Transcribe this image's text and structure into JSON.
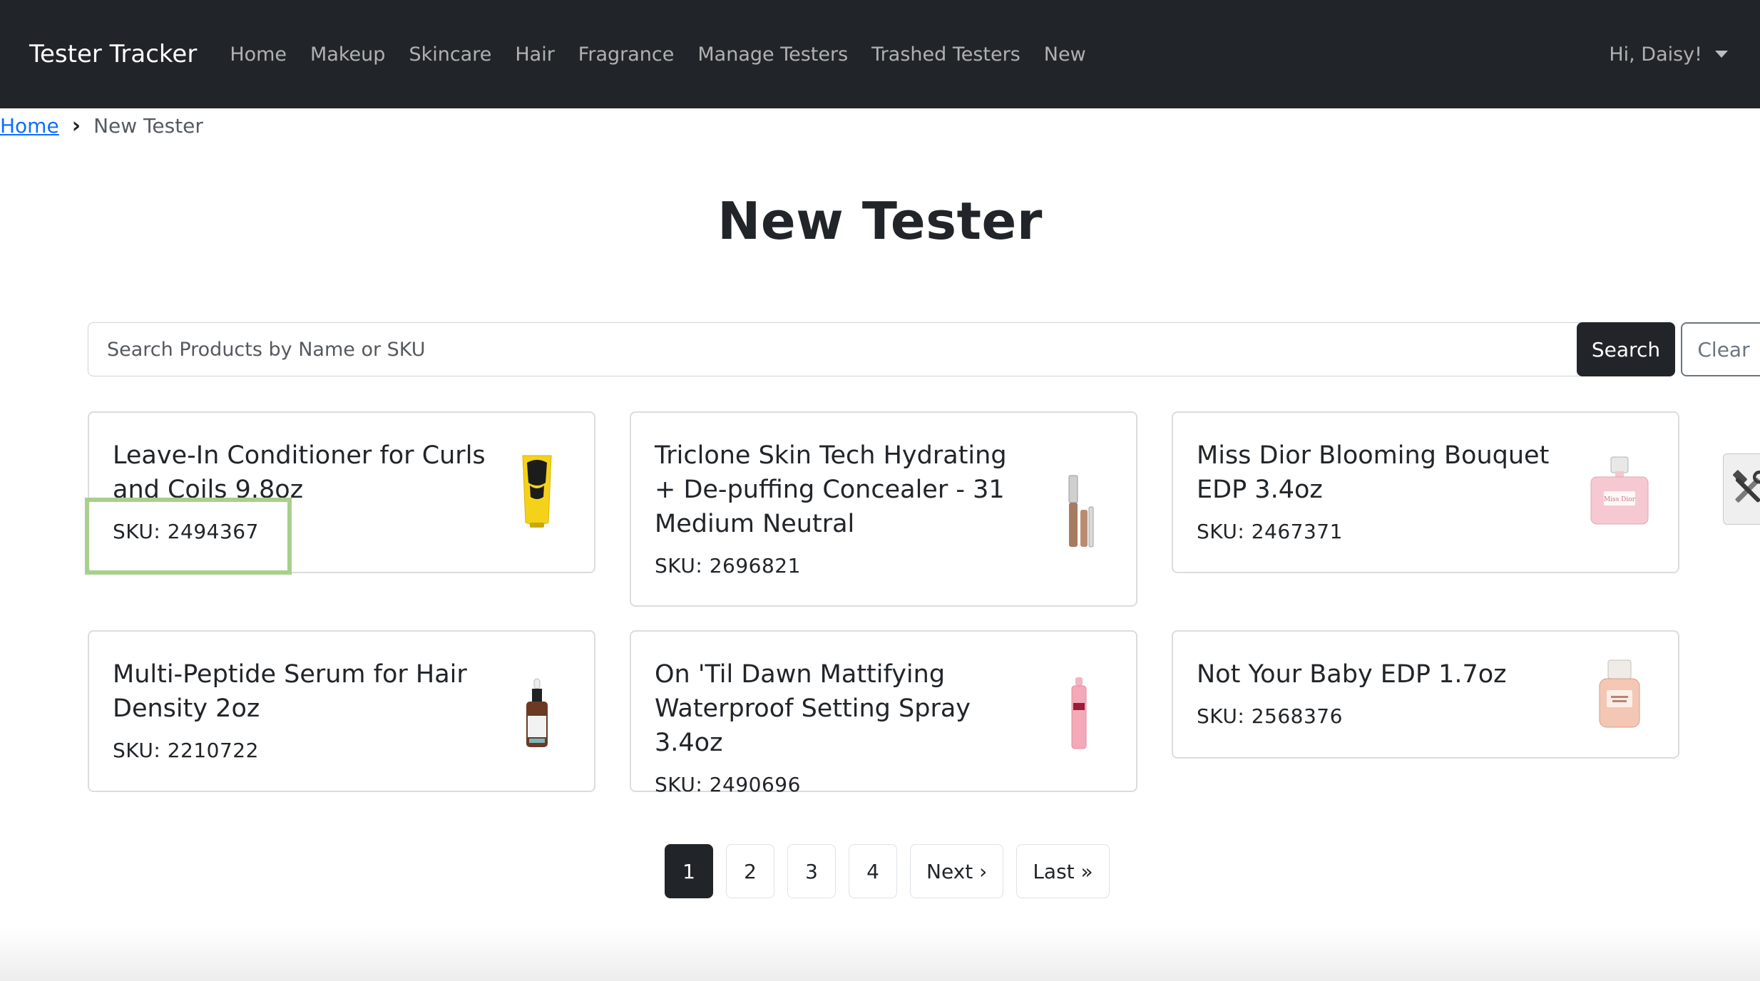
{
  "navbar": {
    "brand": "Tester Tracker",
    "links": [
      "Home",
      "Makeup",
      "Skincare",
      "Hair",
      "Fragrance",
      "Manage Testers",
      "Trashed Testers",
      "New"
    ],
    "user_greeting": "Hi, Daisy!"
  },
  "breadcrumb": {
    "home": "Home",
    "separator": "›",
    "current": "New Tester"
  },
  "page": {
    "title": "New Tester"
  },
  "search": {
    "placeholder": "Search Products by Name or SKU",
    "value": "",
    "search_label": "Search",
    "clear_label": "Clear"
  },
  "products": [
    {
      "name": "Leave-In Conditioner for Curls and Coils 9.8oz",
      "sku": "SKU: 2494367",
      "icon": "yellow-tube-product-icon"
    },
    {
      "name": "Triclone Skin Tech Hydrating + De-puffing Concealer - 31 Medium Neutral",
      "sku": "SKU: 2696821",
      "icon": "concealer-wand-product-icon"
    },
    {
      "name": "Miss Dior Blooming Bouquet EDP 3.4oz",
      "sku": "SKU: 2467371",
      "icon": "pink-perfume-bottle-icon"
    },
    {
      "name": "Multi-Peptide Serum for Hair Density 2oz",
      "sku": "SKU: 2210722",
      "icon": "dropper-bottle-product-icon"
    },
    {
      "name": "On 'Til Dawn Mattifying Waterproof Setting Spray 3.4oz",
      "sku": "SKU: 2490696",
      "icon": "pink-spray-bottle-icon"
    },
    {
      "name": "Not Your Baby EDP 1.7oz",
      "sku": "SKU: 2568376",
      "icon": "perfume-bottle-icon"
    }
  ],
  "pagination": {
    "pages": [
      "1",
      "2",
      "3",
      "4"
    ],
    "active_page": "1",
    "next_label": "Next ›",
    "last_label": "Last »"
  },
  "tool_button": {
    "icon": "tools-icon"
  },
  "colors": {
    "navbar_bg": "#212529",
    "primary_dark": "#212529",
    "link_blue": "#0d6efd",
    "highlight_green": "#a8d08d"
  }
}
